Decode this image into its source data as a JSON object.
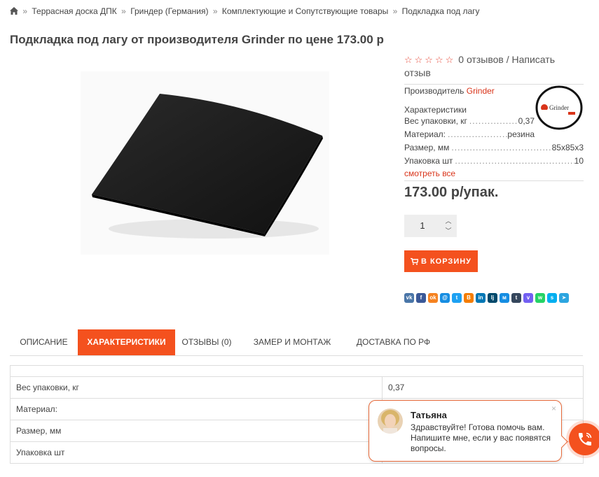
{
  "breadcrumbs": {
    "home_icon": "home-icon",
    "separator": "»",
    "items": [
      "Террасная доска ДПК",
      "Гриндер (Германия)",
      "Комплектующие и Сопутствующие товары",
      "Подкладка под лагу"
    ]
  },
  "product": {
    "title": "Подкладка под лагу от производителя Grinder по цене 173.00 р",
    "image_icon": "product-photo-rubber-pad",
    "rating_stars": "☆☆☆☆☆",
    "rating_value": 0,
    "reviews_text": "0 отзывов / Написать отзыв",
    "manufacturer_label": "Производитель",
    "manufacturer_name": "Grinder",
    "manufacturer_logo_text": "Grinder",
    "characteristics_title": "Характеристики",
    "characteristics": [
      {
        "key": "Вес упаковки, кг",
        "value": "0,37"
      },
      {
        "key": "Материал:",
        "value": "резина"
      },
      {
        "key": "Размер, мм",
        "value": "85x85x3"
      },
      {
        "key": "Упаковка шт",
        "value": "10"
      }
    ],
    "see_all": "смотреть все",
    "price": "173.00 р/упак.",
    "quantity": "1",
    "add_to_cart": "В КОРЗИНУ"
  },
  "share_icons": [
    {
      "name": "vk-icon",
      "color": "#4a76a8",
      "glyph": "vk"
    },
    {
      "name": "facebook-icon",
      "color": "#3b5998",
      "glyph": "f"
    },
    {
      "name": "odnoklassniki-icon",
      "color": "#f58220",
      "glyph": "ok"
    },
    {
      "name": "mailru-icon",
      "color": "#168de2",
      "glyph": "@"
    },
    {
      "name": "twitter-icon",
      "color": "#1da1f2",
      "glyph": "t"
    },
    {
      "name": "blogger-icon",
      "color": "#f57d00",
      "glyph": "B"
    },
    {
      "name": "linkedin-icon",
      "color": "#0077b5",
      "glyph": "in"
    },
    {
      "name": "livejournal-icon",
      "color": "#00496b",
      "glyph": "lj"
    },
    {
      "name": "moimir-icon",
      "color": "#168de2",
      "glyph": "м"
    },
    {
      "name": "tumblr-icon",
      "color": "#35465c",
      "glyph": "t"
    },
    {
      "name": "viber-icon",
      "color": "#7360f2",
      "glyph": "v"
    },
    {
      "name": "whatsapp-icon",
      "color": "#25d366",
      "glyph": "w"
    },
    {
      "name": "skype-icon",
      "color": "#00aff0",
      "glyph": "s"
    },
    {
      "name": "telegram-icon",
      "color": "#2ca5e0",
      "glyph": "➤"
    }
  ],
  "tabs": [
    {
      "label": "ОПИСАНИЕ",
      "active": false
    },
    {
      "label": "ХАРАКТЕРИСТИКИ",
      "active": true
    },
    {
      "label": "ОТЗЫВЫ (0)",
      "active": false
    },
    {
      "label": "ЗАМЕР И МОНТАЖ",
      "active": false
    },
    {
      "label": "ДОСТАВКА ПО РФ",
      "active": false
    }
  ],
  "spec_table": [
    {
      "key": "Вес упаковки, кг",
      "value": "0,37"
    },
    {
      "key": "Материал:",
      "value": ""
    },
    {
      "key": "Размер, мм",
      "value": ""
    },
    {
      "key": "Упаковка шт",
      "value": ""
    }
  ],
  "chat": {
    "agent_name": "Татьяна",
    "message": "Здравствуйте! Готова помочь вам. Напишите мне, если у вас появятся вопросы.",
    "close_glyph": "×"
  },
  "colors": {
    "accent": "#f4511e",
    "link": "#d9341a",
    "chat_border": "#e86a3a"
  }
}
